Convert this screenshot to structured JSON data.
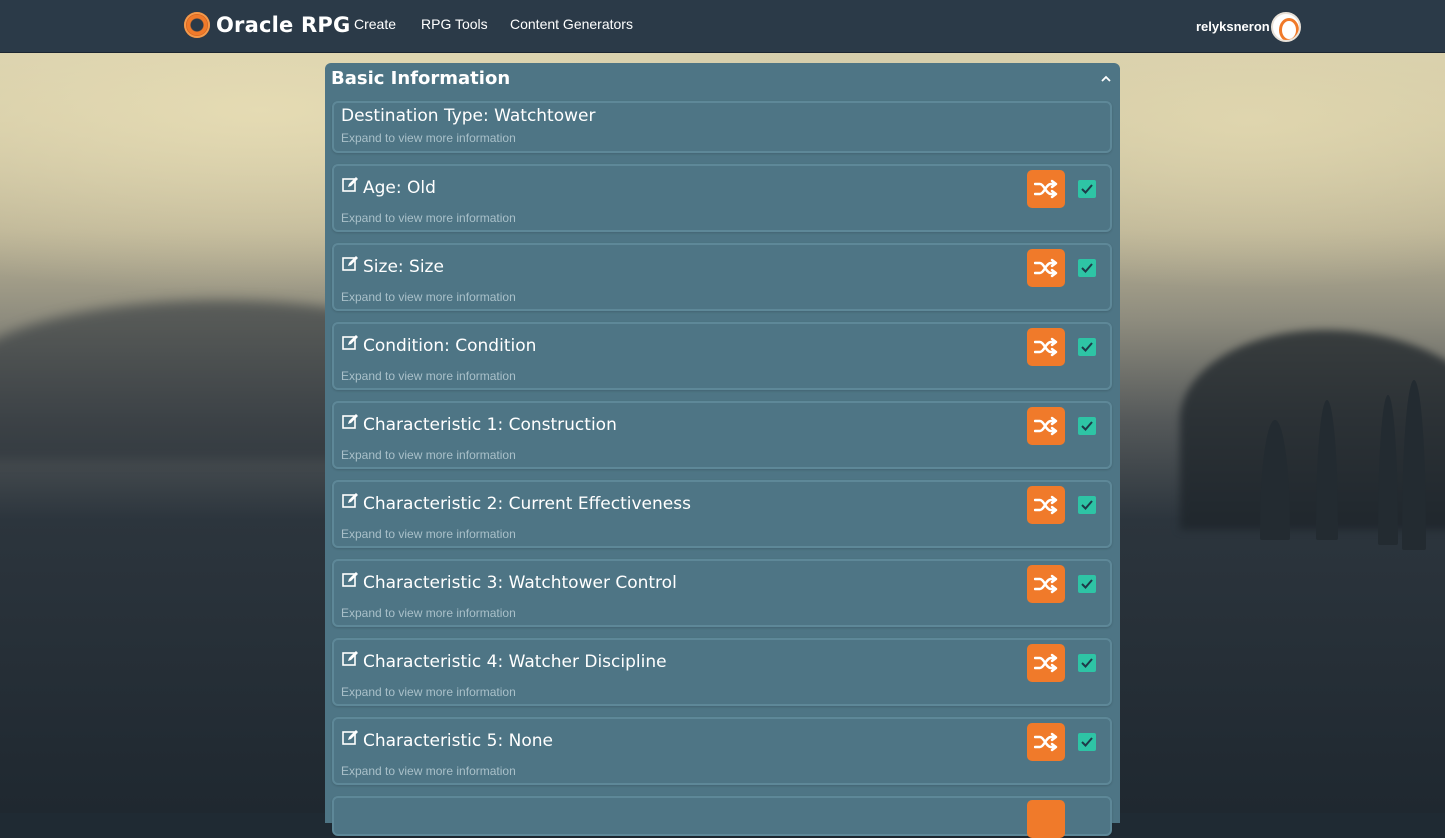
{
  "brand": {
    "name": "Oracle RPG",
    "logo_icon": "oracle-rpg-logo-icon"
  },
  "nav": {
    "links": [
      {
        "label": "Create"
      },
      {
        "label": "RPG Tools"
      },
      {
        "label": "Content Generators"
      }
    ],
    "username": "relyksneron",
    "avatar_icon": "user-avatar-icon"
  },
  "panel": {
    "title": "Basic Information",
    "collapse_icon": "chevron-up-icon",
    "destination": {
      "title": "Destination Type: Watchtower",
      "subtitle": "Expand to view more information"
    },
    "items": [
      {
        "title": "Age: Old",
        "subtitle": "Expand to view more information",
        "checked": true
      },
      {
        "title": "Size: Size",
        "subtitle": "Expand to view more information",
        "checked": true
      },
      {
        "title": "Condition: Condition",
        "subtitle": "Expand to view more information",
        "checked": true
      },
      {
        "title": "Characteristic 1: Construction",
        "subtitle": "Expand to view more information",
        "checked": true
      },
      {
        "title": "Characteristic 2: Current Effectiveness",
        "subtitle": "Expand to view more information",
        "checked": true
      },
      {
        "title": "Characteristic 3: Watchtower Control",
        "subtitle": "Expand to view more information",
        "checked": true
      },
      {
        "title": "Characteristic 4: Watcher Discipline",
        "subtitle": "Expand to view more information",
        "checked": true
      },
      {
        "title": "Characteristic 5: None",
        "subtitle": "Expand to view more information",
        "checked": true
      }
    ],
    "item_icons": {
      "edit": "edit-icon",
      "shuffle": "shuffle-icon",
      "check": "checkbox-checked-icon"
    }
  },
  "colors": {
    "navbar": "#2b3a48",
    "panel": "#4e7585",
    "accent_orange": "#f07a2a",
    "check_teal": "#2ec4a5",
    "subtitle": "#a9c0c9"
  }
}
